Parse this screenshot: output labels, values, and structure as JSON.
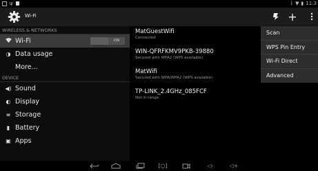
{
  "status_bar": {
    "time": "11:3",
    "left_icons": [
      "notification-square-icon",
      "usb-icon",
      "square-icon"
    ],
    "right_icons": [
      "bluetooth-icon",
      "wifi-signal-icon",
      "battery-icon"
    ]
  },
  "action_bar": {
    "title": "Wi-Fi",
    "app_icon": "settings-gear-icon",
    "actions": [
      "wps-push-icon",
      "add-icon",
      "overflow-menu-icon"
    ]
  },
  "sidebar": {
    "sections": [
      {
        "header": "WIRELESS & NETWORKS",
        "items": [
          {
            "label": "Wi-Fi",
            "icon": "wifi-icon",
            "selected": true,
            "toggle": "ON"
          },
          {
            "label": "Data usage",
            "icon": "data-usage-icon"
          },
          {
            "label": "More...",
            "icon": ""
          }
        ]
      },
      {
        "header": "DEVICE",
        "items": [
          {
            "label": "Sound",
            "icon": "sound-icon"
          },
          {
            "label": "Display",
            "icon": "display-icon"
          },
          {
            "label": "Storage",
            "icon": "storage-icon"
          },
          {
            "label": "Battery",
            "icon": "battery-icon"
          },
          {
            "label": "Apps",
            "icon": "apps-icon"
          }
        ]
      }
    ]
  },
  "networks": [
    {
      "ssid": "MatGuestWifi",
      "status": "Connected"
    },
    {
      "ssid": "WIN-QFRFKMV9PKB-39880",
      "status": "Secured with WPA2 (WPS available)"
    },
    {
      "ssid": "MatWifi",
      "status": "Secured with WPA/WPA2 (WPS available)"
    },
    {
      "ssid": "TP-LINK_2.4GHz_085FCF",
      "status": "Not in range"
    }
  ],
  "overflow_menu": {
    "items": [
      "Scan",
      "WPS Pin Entry",
      "Wi-Fi Direct",
      "Advanced"
    ]
  },
  "nav_bar": {
    "buttons": [
      "back-icon",
      "home-icon",
      "recents-icon",
      "screenshot-icon",
      "camera-icon",
      "volume-down-icon",
      "volume-up-icon"
    ]
  }
}
